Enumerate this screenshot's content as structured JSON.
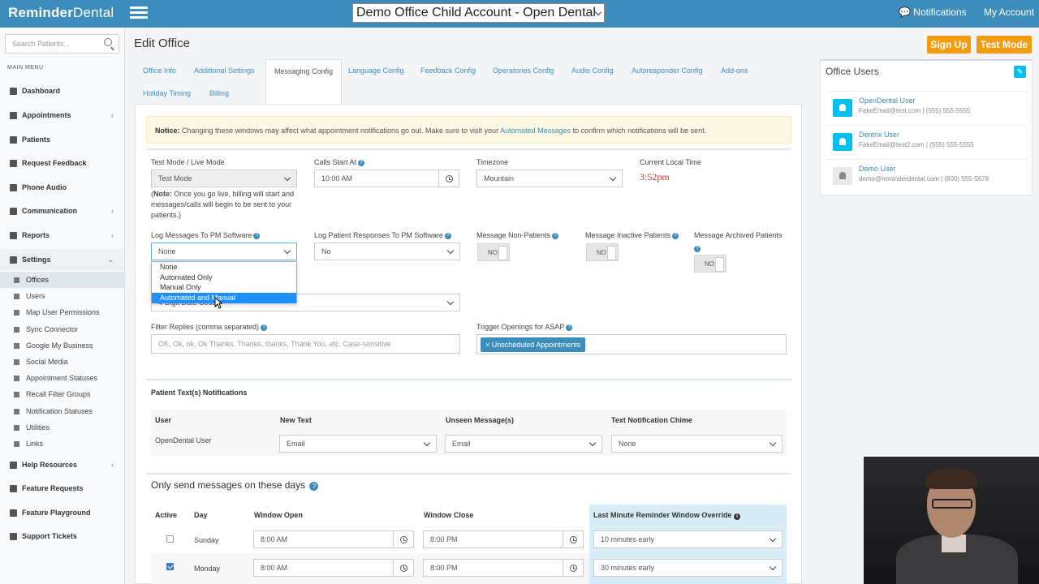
{
  "topbar": {
    "logo_bold": "Reminder",
    "logo_thin": "Dental",
    "account_select": "Demo Office Child Account - Open Dental",
    "notifications": "Notifications",
    "my_account": "My Account"
  },
  "sidebar": {
    "search_placeholder": "Search Patients...",
    "menu_heading": "MAIN MENU",
    "items": [
      {
        "label": "Dashboard"
      },
      {
        "label": "Appointments"
      },
      {
        "label": "Patients"
      },
      {
        "label": "Request Feedback"
      },
      {
        "label": "Phone Audio"
      },
      {
        "label": "Communication"
      },
      {
        "label": "Reports"
      },
      {
        "label": "Settings"
      }
    ],
    "settings_sub": [
      {
        "label": "Offices"
      },
      {
        "label": "Users"
      },
      {
        "label": "Map User Permissions"
      },
      {
        "label": "Sync Connector"
      },
      {
        "label": "Google My Business"
      },
      {
        "label": "Social Media"
      },
      {
        "label": "Appointment Statuses"
      },
      {
        "label": "Recall Filter Groups"
      },
      {
        "label": "Notification Statuses"
      },
      {
        "label": "Utilities"
      },
      {
        "label": "Links"
      }
    ],
    "bottom_items": [
      {
        "label": "Help Resources"
      },
      {
        "label": "Feature Requests"
      },
      {
        "label": "Feature Playground"
      },
      {
        "label": "Support Tickets"
      }
    ]
  },
  "page": {
    "title": "Edit Office",
    "sign_up": "Sign Up",
    "test_mode": "Test Mode"
  },
  "tabs": [
    {
      "label": "Office Info"
    },
    {
      "label": "Additional Settings"
    },
    {
      "label": "Messaging Config"
    },
    {
      "label": "Language Config"
    },
    {
      "label": "Feedback Config"
    },
    {
      "label": "Operatories Config"
    },
    {
      "label": "Audio Config"
    },
    {
      "label": "Autoresponder Config"
    },
    {
      "label": "Add-ons"
    },
    {
      "label": "Holiday Timing"
    },
    {
      "label": "Billing"
    }
  ],
  "notice": {
    "bold": "Notice:",
    "text": " Changing these windows may affect what appointment notifications go out. Make sure to visit your ",
    "link": "Automated Messages",
    "tail": " to confirm which notifications will be sent."
  },
  "form": {
    "test_live_label": "Test Mode / Live Mode",
    "test_live_value": "Test Mode",
    "note_bold": "Note:",
    "note_text": " Once you go live, billing will start and messages/calls will begin to be sent to your patients.)",
    "note_open": "(",
    "calls_start_label": "Calls Start At",
    "calls_start_value": "10:00 AM",
    "timezone_label": "Timezone",
    "timezone_value": "Mountain",
    "local_time_label": "Current Local Time",
    "local_time_value": "3:52pm",
    "log_messages_label": "Log Messages To PM Software",
    "log_messages_value": "None",
    "log_responses_label": "Log Patient Responses To PM Software",
    "log_responses_value": "No",
    "non_patients_label": "Message Non-Patients",
    "inactive_label": "Message Inactive Patients",
    "archived_label": "Message Archived Patients",
    "toggle_no": "NO",
    "dropdown_options": [
      "None",
      "Automated Only",
      "Manual Only",
      "Automated and Manual"
    ],
    "hidden_select_value": "4-Digit Date Code",
    "filter_label": "Filter Replies (comma separated)",
    "filter_placeholder": "OK, Ok, ok, Ok Thanks, Thanks, thanks, Thank You, etc. Case-sensitive",
    "trigger_label": "Trigger Openings for ASAP",
    "trigger_tag": "× Unscheduled Appointments"
  },
  "notifications_table": {
    "heading": "Patient Text(s) Notifications",
    "headers": [
      "User",
      "New Text",
      "Unseen Message(s)",
      "Text Notification Chime"
    ],
    "rows": [
      {
        "user": "OpenDental User",
        "new_text": "Email",
        "unseen": "Email",
        "chime": "None"
      }
    ]
  },
  "days": {
    "heading": "Only send messages on these days",
    "headers": [
      "Active",
      "Day",
      "Window Open",
      "Window Close",
      "Last Minute Reminder Window Override"
    ],
    "rows": [
      {
        "day": "Sunday",
        "open": "8:00 AM",
        "close": "8:00 PM",
        "override": "10 minutes early"
      },
      {
        "day": "Monday",
        "open": "8:00 AM",
        "close": "8:00 PM",
        "override": "30 minutes early"
      }
    ]
  },
  "office_users": {
    "title": "Office Users",
    "users": [
      {
        "name": "OpenDental User",
        "info": "FakeEmail@test.com | (555) 555-5555"
      },
      {
        "name": "Dentrix User",
        "info": "FakeEmail@test2.com | (555) 555-5555"
      },
      {
        "name": "Demo User",
        "info": "demo@reminderdental.com | (800) 555-5678"
      }
    ]
  }
}
